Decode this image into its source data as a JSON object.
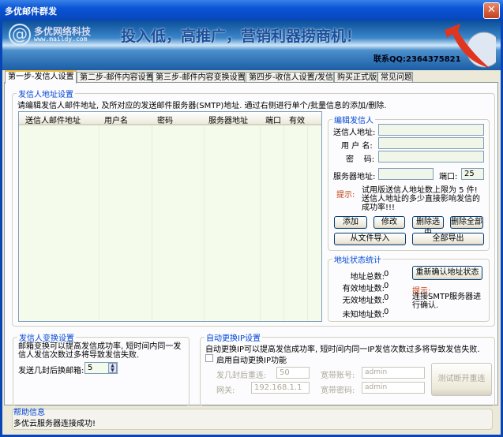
{
  "window": {
    "title": "多优邮件群发",
    "close": "✕"
  },
  "banner": {
    "company": "多优网络科技",
    "site": "www.maildy.com",
    "slogan": "投入低，高推广，营销利器捞商机！",
    "contact": "联系QQ:2364375821"
  },
  "tabs": [
    "第一步-发信人设置",
    "第二步-邮件内容设置",
    "第三步-邮件内容变换设置",
    "第四步-收信人设置/发信",
    "购买正式版",
    "常见问题"
  ],
  "sender_group": {
    "title": "发信人地址设置",
    "description": "请编辑发信人邮件地址, 及所对应的发送邮件服务器(SMTP)地址. 通过右侧进行单个/批量信息的添加/删除.",
    "columns": [
      "送信人邮件地址",
      "用户名",
      "密码",
      "服务器地址",
      "端口",
      "有效"
    ],
    "rows": []
  },
  "edit_group": {
    "title": "编辑发信人",
    "sender_label": "送信人地址:",
    "sender_value": "",
    "user_label": "用 户 名:",
    "user_value": "",
    "password_label": "密    码:",
    "password_value": "",
    "server_label": "服务器地址:",
    "server_value": "",
    "port_label": "端口:",
    "port_value": "25",
    "tip_label": "提示:",
    "tip_text": "试用版送信人地址数上限为 5 件! 送信人地址的多少直接影响发信的成功率!!!",
    "add": "添加",
    "modify": "修改",
    "delete_selected": "删除选中",
    "delete_all": "删除全部",
    "import": "从文件导入",
    "export": "全部导出"
  },
  "stats_group": {
    "title": "地址状态统计",
    "total_label": "地址总数:",
    "total": "0",
    "valid_label": "有效地址数:",
    "valid": "0",
    "invalid_label": "无效地址数:",
    "invalid": "0",
    "unknown_label": "未知地址数:",
    "unknown": "0",
    "reconfirm": "重新确认地址状态",
    "tip_label": "提示:",
    "tip_text": "连接SMTP服务器进行确认."
  },
  "rotate_group": {
    "title": "发信人变换设置",
    "description": "邮箱变换可以提高发信成功率, 短时间内同一发信人发信次数过多将导致发信失败.",
    "count_label": "发送几封后换邮箱:",
    "count_value": "5"
  },
  "ip_group": {
    "title": "自动更换IP设置",
    "description": "自动更换IP可以提高发信成功率, 短时间内同一IP发信次数过多将导致发信失败.",
    "enable_label": "启用自动更换IP功能",
    "enabled": false,
    "reconnect_label": "发几封后重连:",
    "reconnect_value": "50",
    "gateway_label": "网关:",
    "gateway_value": "192.168.1.1",
    "account_label": "宽带账号:",
    "account_value": "admin",
    "password_label": "宽带密码:",
    "password_value": "admin",
    "test": "测试断开重连"
  },
  "help": {
    "title": "帮助信息",
    "message": "多优云服务器连接成功!"
  }
}
